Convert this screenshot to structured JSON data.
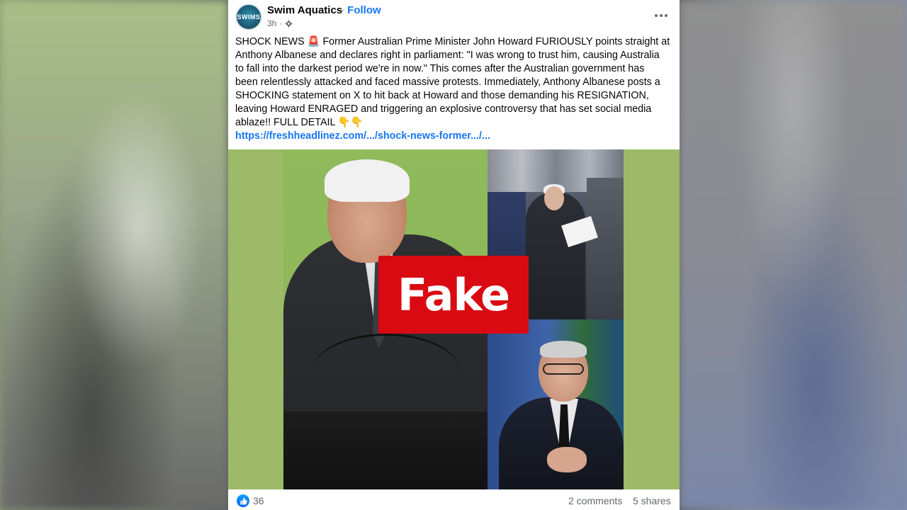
{
  "post": {
    "page_name": "Swim Aquatics",
    "separator": "·",
    "follow_label": "Follow",
    "time": "3h",
    "audience_icon": "settings-gear-icon",
    "more_icon": "more-options-icon",
    "avatar_text": "SWIMS",
    "text_line1": "SHOCK NEWS 🚨 Former Australian Prime Minister John Howard FURIOUSLY points straight at",
    "text_line2": "Anthony Albanese and declares right in parliament: \"I was wrong to trust him, causing Australia",
    "text_line3": "to fall into the darkest period we're in now.\" This comes after the Australian government has",
    "text_line4": "been relentlessly attacked and faced massive protests. Immediately, Anthony Albanese posts a",
    "text_line5": "SHOCKING statement on X to hit back at Howard and those demanding his RESIGNATION,",
    "text_line6": "leaving Howard ENRAGED and triggering an explosive controversy that has set social media",
    "text_line7": "ablaze!! FULL DETAIL 👇👇",
    "link": "https://freshheadlinez.com/.../shock-news-former.../..."
  },
  "media": {
    "overlay_label": "Fake",
    "overlay_color": "#d90a12"
  },
  "footer": {
    "like_icon": "thumbs-up-icon",
    "reactions_count": "36",
    "comments": "2 comments",
    "shares": "5 shares"
  },
  "colors": {
    "link": "#1877f2",
    "text": "#050505",
    "muted": "#65676b"
  }
}
